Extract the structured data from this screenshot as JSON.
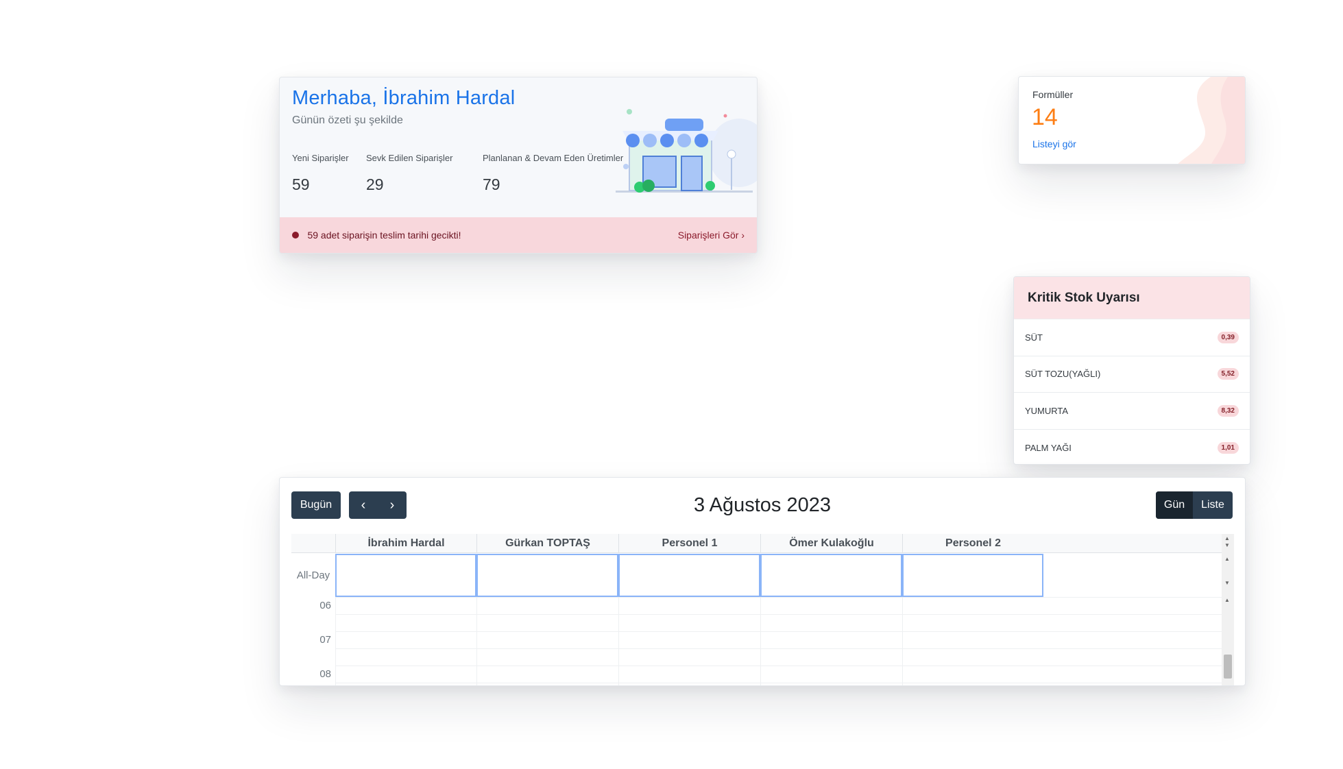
{
  "welcome": {
    "title": "Merhaba, İbrahim Hardal",
    "subtitle": "Günün özeti şu şekilde",
    "stats": [
      {
        "label": "Yeni Siparişler",
        "value": "59"
      },
      {
        "label": "Sevk Edilen Siparişler",
        "value": "29"
      },
      {
        "label": "Planlanan & Devam Eden Üretimler",
        "value": "79"
      }
    ],
    "alert_text": "59 adet siparişin teslim tarihi gecikti!",
    "orders_link": "Siparişleri Gör",
    "orders_chevron": "›"
  },
  "formulas": {
    "label": "Formüller",
    "value": "14",
    "link": "Listeyi gör"
  },
  "stock": {
    "title": "Kritik Stok Uyarısı",
    "items": [
      {
        "name": "SÜT",
        "value": "0,39"
      },
      {
        "name": "SÜT TOZU(YAĞLI)",
        "value": "5,52"
      },
      {
        "name": "YUMURTA",
        "value": "8,32"
      },
      {
        "name": "PALM YAĞI",
        "value": "1,01"
      }
    ]
  },
  "calendar": {
    "today_label": "Bugün",
    "prev_glyph": "‹",
    "next_glyph": "›",
    "title": "3 Ağustos 2023",
    "view_day": "Gün",
    "view_list": "Liste",
    "resources": [
      "İbrahim Hardal",
      "Gürkan TOPTAŞ",
      "Personel 1",
      "Ömer Kulakoğlu",
      "Personel 2"
    ],
    "allday_label": "All-Day",
    "hours": [
      "06",
      "07",
      "08"
    ]
  },
  "colors": {
    "accent_blue": "#1a73e8",
    "orange": "#fd7e14",
    "alert_bg": "#f8d7dc",
    "dark_button": "#2c3e50"
  }
}
